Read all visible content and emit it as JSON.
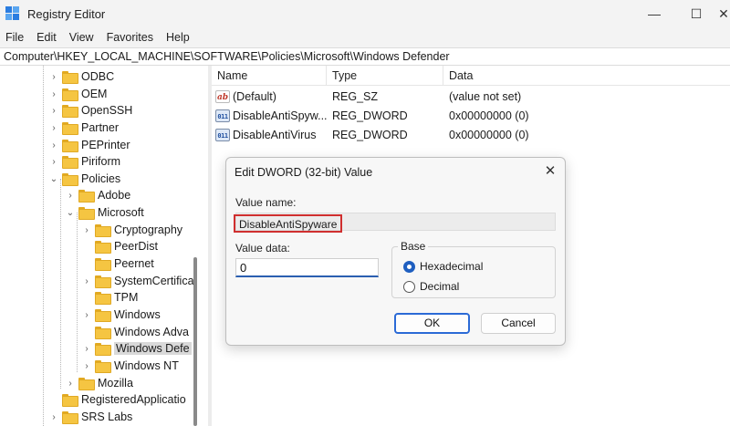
{
  "window": {
    "title": "Registry Editor",
    "minimize": "—",
    "maximize": "☐"
  },
  "menu": [
    "File",
    "Edit",
    "View",
    "Favorites",
    "Help"
  ],
  "address": "Computer\\HKEY_LOCAL_MACHINE\\SOFTWARE\\Policies\\Microsoft\\Windows Defender",
  "tree": [
    {
      "label": "ODBC",
      "expander": "›"
    },
    {
      "label": "OEM",
      "expander": "›"
    },
    {
      "label": "OpenSSH",
      "expander": "›"
    },
    {
      "label": "Partner",
      "expander": "›"
    },
    {
      "label": "PEPrinter",
      "expander": "›"
    },
    {
      "label": "Piriform",
      "expander": "›"
    },
    {
      "label": "Policies",
      "expander": "⌄"
    },
    {
      "label": "Adobe",
      "expander": "›"
    },
    {
      "label": "Microsoft",
      "expander": "⌄"
    },
    {
      "label": "Cryptography",
      "expander": "›"
    },
    {
      "label": "PeerDist",
      "expander": ""
    },
    {
      "label": "Peernet",
      "expander": ""
    },
    {
      "label": "SystemCertifica",
      "expander": "›"
    },
    {
      "label": "TPM",
      "expander": ""
    },
    {
      "label": "Windows",
      "expander": "›"
    },
    {
      "label": "Windows Adva",
      "expander": ""
    },
    {
      "label": "Windows Defe",
      "expander": "›"
    },
    {
      "label": "Windows NT",
      "expander": "›"
    },
    {
      "label": "Mozilla",
      "expander": "›"
    },
    {
      "label": "RegisteredApplicatio",
      "expander": ""
    },
    {
      "label": "SRS Labs",
      "expander": "›"
    }
  ],
  "list": {
    "columns": [
      "Name",
      "Type",
      "Data"
    ],
    "rows": [
      {
        "icon": "string-value-icon",
        "icon_glyph": "ab",
        "name": "(Default)",
        "type": "REG_SZ",
        "data": "(value not set)"
      },
      {
        "icon": "binary-value-icon",
        "icon_glyph": "011",
        "name": "DisableAntiSpyw...",
        "type": "REG_DWORD",
        "data": "0x00000000 (0)"
      },
      {
        "icon": "binary-value-icon",
        "icon_glyph": "011",
        "name": "DisableAntiVirus",
        "type": "REG_DWORD",
        "data": "0x00000000 (0)"
      }
    ]
  },
  "dialog": {
    "title": "Edit DWORD (32-bit) Value",
    "close": "✕",
    "value_name_label": "Value name:",
    "value_name": "DisableAntiSpyware",
    "value_data_label": "Value data:",
    "value_data": "0",
    "base_label": "Base",
    "radio_hex": "Hexadecimal",
    "radio_dec": "Decimal",
    "selected_base": "Hexadecimal",
    "ok": "OK",
    "cancel": "Cancel"
  },
  "colors": {
    "accent": "#1f5fc0",
    "highlight_box": "#d02f2f",
    "folder": "#f5c542"
  }
}
